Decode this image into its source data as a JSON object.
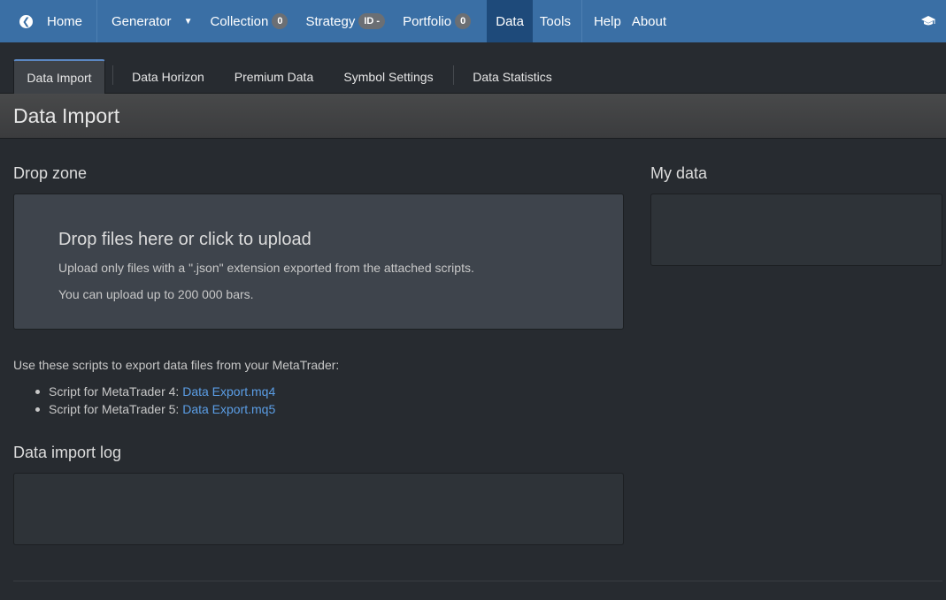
{
  "navbar": {
    "home": "Home",
    "generator": "Generator",
    "collection": "Collection",
    "collection_badge": "0",
    "strategy": "Strategy",
    "strategy_badge": "ID -",
    "portfolio": "Portfolio",
    "portfolio_badge": "0",
    "data": "Data",
    "tools": "Tools",
    "help": "Help",
    "about": "About",
    "icons": {
      "back": "arrow-left-circle-icon",
      "caret": "caret-down-icon",
      "cap": "graduation-cap-icon"
    },
    "colors": {
      "bar": "#3a6fa5",
      "active": "#1e4a7a"
    }
  },
  "tabs": [
    {
      "label": "Data Import",
      "active": true
    },
    {
      "label": "Data Horizon",
      "active": false
    },
    {
      "label": "Premium Data",
      "active": false
    },
    {
      "label": "Symbol Settings",
      "active": false
    },
    {
      "label": "Data Statistics",
      "active": false
    }
  ],
  "page": {
    "title": "Data Import"
  },
  "drop_zone": {
    "heading": "Drop zone",
    "title": "Drop files here or click to upload",
    "line1": "Upload only files with a \".json\" extension exported from the attached scripts.",
    "line2": "You can upload up to 200 000 bars."
  },
  "my_data": {
    "heading": "My data"
  },
  "scripts": {
    "intro": "Use these scripts to export data files from your MetaTrader:",
    "items": [
      {
        "label": "Script for MetaTrader 4:",
        "link": "Data Export.mq4"
      },
      {
        "label": "Script for MetaTrader 5:",
        "link": "Data Export.mq5"
      }
    ]
  },
  "import_log": {
    "heading": "Data import log"
  },
  "colors": {
    "link": "#5b9ee6",
    "background": "#272b30",
    "drop_zone": "#3e444c"
  }
}
